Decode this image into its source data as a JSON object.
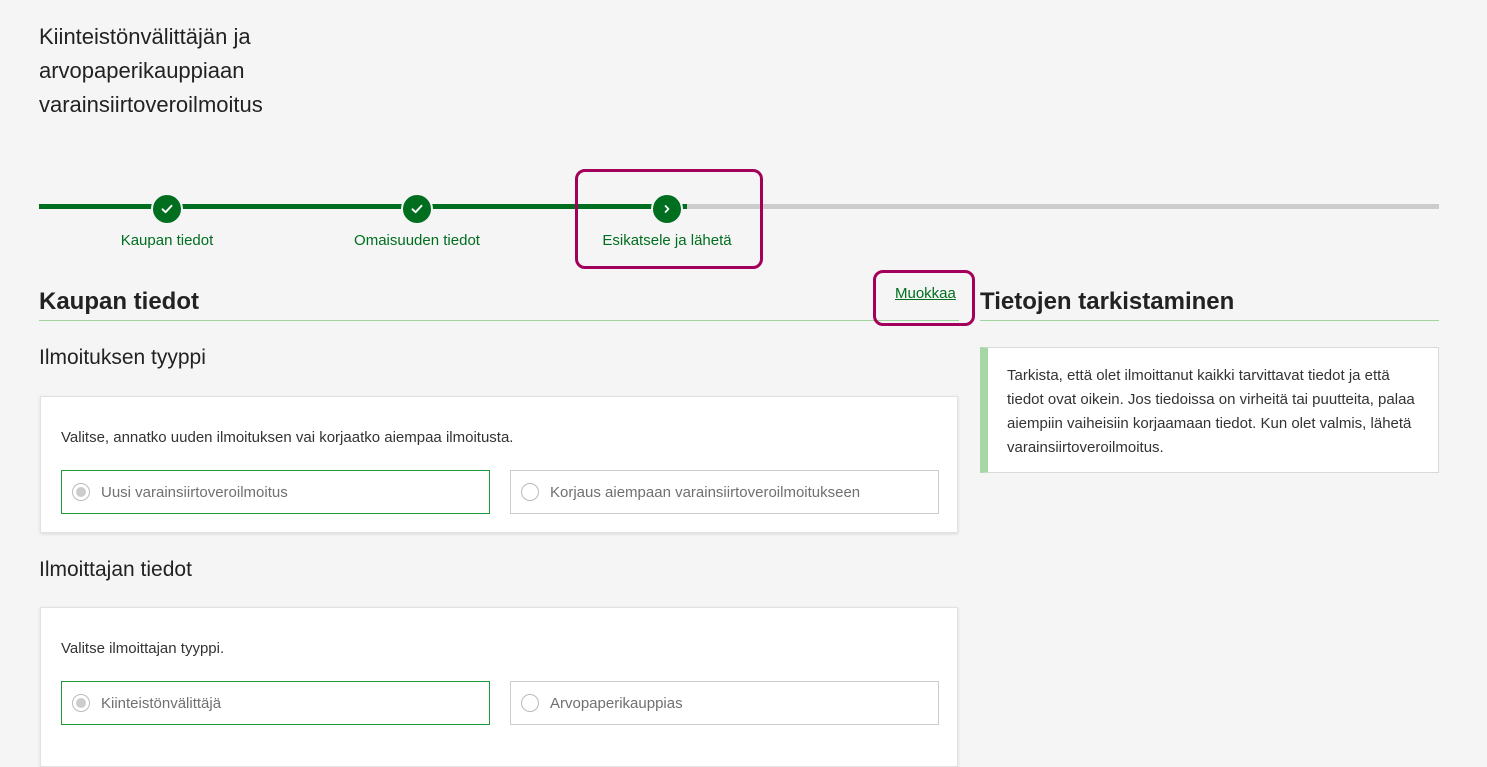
{
  "page": {
    "title_lines": [
      "Kiinteistönvälittäjän ja",
      "arvopaperikauppiaan",
      "varainsiirtoveroilmoitus"
    ]
  },
  "stepper": {
    "steps": [
      {
        "label": "Kaupan tiedot",
        "status": "completed",
        "icon": "check-icon"
      },
      {
        "label": "Omaisuuden tiedot",
        "status": "completed",
        "icon": "check-icon"
      },
      {
        "label": "Esikatsele ja lähetä",
        "status": "current",
        "icon": "chevron-right-icon"
      }
    ]
  },
  "main": {
    "section_title": "Kaupan tiedot",
    "edit_link": "Muokkaa",
    "notification_type": {
      "heading": "Ilmoituksen tyyppi",
      "prompt": "Valitse, annatko uuden ilmoituksen vai korjaatko aiempaa ilmoitusta.",
      "options": [
        {
          "label": "Uusi varainsiirtoveroilmoitus",
          "selected": true
        },
        {
          "label": "Korjaus aiempaan varainsiirtoveroilmoitukseen",
          "selected": false
        }
      ]
    },
    "reporter": {
      "heading": "Ilmoittajan tiedot",
      "prompt": "Valitse ilmoittajan tyyppi.",
      "options": [
        {
          "label": "Kiinteistönvälittäjä",
          "selected": true
        },
        {
          "label": "Arvopaperikauppias",
          "selected": false
        }
      ]
    }
  },
  "sidebar": {
    "title": "Tietojen tarkistaminen",
    "info_text": "Tarkista, että olet ilmoittanut kaikki tarvittavat tiedot ja että tiedot ovat oikein. Jos tiedoissa on virheitä tai puutteita, palaa aiempiin vaiheisiin korjaamaan tiedot. Kun olet valmis, lähetä varainsiirtoveroilmoitus."
  },
  "colors": {
    "accent_green": "#006e1f",
    "highlight_magenta": "#a3005c",
    "track_gray": "#cccccc",
    "rule_green": "#9fd49f"
  }
}
